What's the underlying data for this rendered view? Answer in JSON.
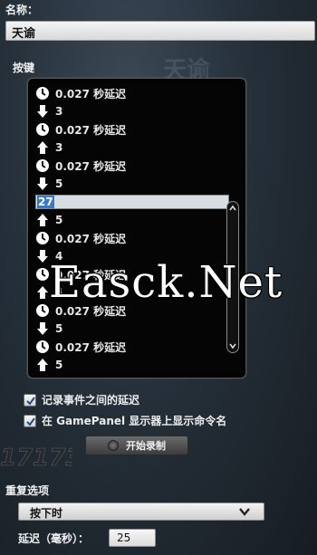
{
  "name_label": "名称：",
  "name_value": "天谕",
  "keys_label": "按键",
  "events": [
    {
      "type": "delay",
      "icon": "clock-icon",
      "text": "0.027 秒延迟"
    },
    {
      "type": "keydown",
      "icon": "arrow-down-icon",
      "text": "3"
    },
    {
      "type": "delay",
      "icon": "clock-icon",
      "text": "0.027 秒延迟"
    },
    {
      "type": "keyup",
      "icon": "arrow-up-icon",
      "text": "3"
    },
    {
      "type": "delay",
      "icon": "clock-icon",
      "text": "0.027 秒延迟"
    },
    {
      "type": "keydown",
      "icon": "arrow-down-icon",
      "text": "5"
    },
    {
      "type": "editing",
      "icon": "",
      "text": "27"
    },
    {
      "type": "keyup",
      "icon": "arrow-up-icon",
      "text": "5"
    },
    {
      "type": "delay",
      "icon": "clock-icon",
      "text": "0.027 秒延迟"
    },
    {
      "type": "keydown",
      "icon": "arrow-down-icon",
      "text": "4"
    },
    {
      "type": "delay",
      "icon": "clock-icon",
      "text": "0.027 秒延迟"
    },
    {
      "type": "keyup",
      "icon": "arrow-up-icon",
      "text": "4"
    },
    {
      "type": "delay",
      "icon": "clock-icon",
      "text": "0.027 秒延迟"
    },
    {
      "type": "keydown",
      "icon": "arrow-down-icon",
      "text": "5"
    },
    {
      "type": "delay",
      "icon": "clock-icon",
      "text": "0.027 秒延迟"
    },
    {
      "type": "keyup",
      "icon": "arrow-up-icon",
      "text": "5"
    }
  ],
  "options": {
    "record_delays": {
      "label": "记录事件之间的延迟",
      "checked": true
    },
    "show_on_gamepanel": {
      "label": "在 GamePanel 显示器上显示命令名",
      "checked": true
    }
  },
  "record_button_label": "开始录制",
  "repeat": {
    "label": "重复选项",
    "selected": "按下时"
  },
  "delay": {
    "label": "延迟（毫秒）：",
    "value": "25"
  },
  "watermark": "Easck.Net",
  "colors": {
    "background": "#25303a",
    "panel": "#050505",
    "selection": "#3a78c8"
  }
}
